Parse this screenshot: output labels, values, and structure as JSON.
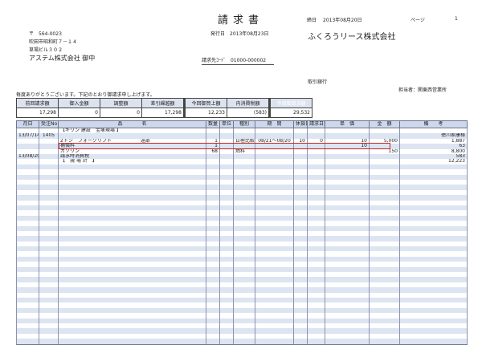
{
  "doc": {
    "title": "請求書",
    "issue_label": "発行日",
    "issue_date": "2013年08月23日",
    "close_label": "締日",
    "close_date": "2013年08月20日",
    "page_label": "ページ",
    "page_num": "1",
    "code_label": "請求先ｺｰﾄﾞ",
    "code_value": "01000-000002"
  },
  "recipient": {
    "zip": "〒　564-0023",
    "addr1": "吹田市昭和町７－１４",
    "addr2": "草場ビル３０２",
    "company": "アステム株式会社 御中"
  },
  "issuer": {
    "company": "ふくろうリース株式会社",
    "bank": "取引銀行",
    "office": "担当者：関東西営業所"
  },
  "greeting": "毎度ありがとうございます。下記のとおり御請求申し上げます。",
  "summary": {
    "headers": [
      "前回請求額",
      "御入金額",
      "調整額",
      "差引繰越額",
      "今回御買上額",
      "内消費税額",
      "今回御請求額"
    ],
    "values": [
      "17,298",
      "0",
      "0",
      "17,298",
      "12,233",
      "(583)",
      "29,532"
    ]
  },
  "table": {
    "headers": [
      "月日",
      "受注No",
      "品　　　　名",
      "数量",
      "単位",
      "種別",
      "期　間",
      "休損日数",
      "請求日数",
      "単　価",
      "金　額",
      "備　　考"
    ],
    "rows": [
      [
        "",
        "",
        "【キリン 建設　宝塚現場 】",
        "",
        "",
        "",
        "",
        "",
        "",
        "",
        "",
        ""
      ],
      [
        "13/07/14",
        "1405",
        "",
        "",
        "",
        "",
        "",
        "",
        "",
        "",
        "",
        "徳川家康様"
      ],
      [
        "",
        "",
        "2トン　フォークリフト　　　　　　遠部",
        "1",
        "",
        "日極比較",
        "08/21～08/20",
        "10",
        "0",
        "10",
        "5,000",
        "1,887"
      ],
      [
        "",
        "",
        "補償料",
        "1",
        "",
        "",
        "",
        "",
        "",
        "10",
        "",
        "63"
      ],
      [
        "",
        "",
        "ガソリン",
        "68",
        "",
        "燃料",
        "",
        "",
        "",
        "",
        "150",
        "8,800"
      ],
      [
        "13/08/20",
        "",
        "請求時消費税",
        "",
        "",
        "",
        "",
        "",
        "",
        "",
        "",
        "583"
      ],
      [
        "",
        "",
        "【　規 場 計　】",
        "",
        "",
        "",
        "",
        "",
        "",
        "",
        "",
        "12,223"
      ]
    ],
    "blank_rows": 35
  }
}
